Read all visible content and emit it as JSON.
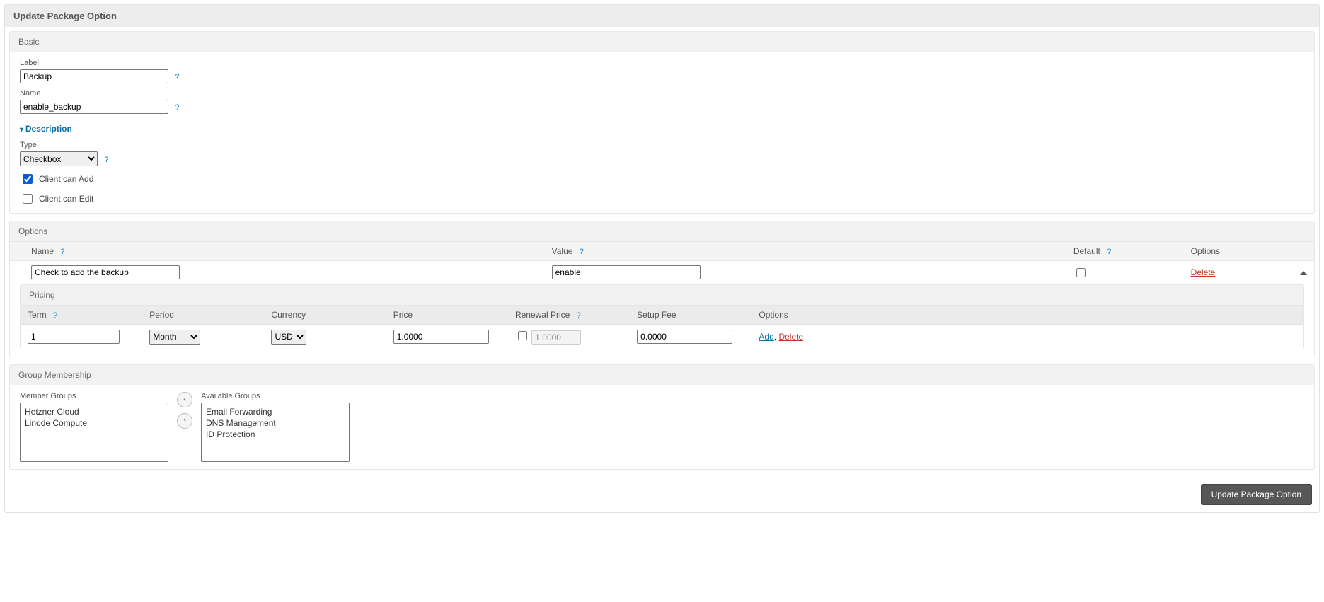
{
  "panel_title": "Update Package Option",
  "sections": {
    "basic": {
      "title": "Basic",
      "label_label": "Label",
      "label_value": "Backup",
      "name_label": "Name",
      "name_value": "enable_backup",
      "description_toggle": "Description",
      "type_label": "Type",
      "type_value": "Checkbox",
      "client_add": {
        "label": "Client can Add",
        "checked": true
      },
      "client_edit": {
        "label": "Client can Edit",
        "checked": false
      }
    },
    "options": {
      "title": "Options",
      "headers": {
        "name": "Name",
        "value": "Value",
        "default": "Default",
        "options": "Options"
      },
      "row": {
        "name_value": "Check to add the backup",
        "value_value": "enable",
        "default_checked": false,
        "delete": "Delete"
      }
    },
    "pricing": {
      "title": "Pricing",
      "headers": {
        "term": "Term",
        "period": "Period",
        "currency": "Currency",
        "price": "Price",
        "renewal": "Renewal Price",
        "setup": "Setup Fee",
        "options": "Options"
      },
      "row": {
        "term": "1",
        "period": "Month",
        "currency": "USD",
        "price": "1.0000",
        "renewal_checked": false,
        "renewal": "1.0000",
        "setup": "0.0000",
        "add": "Add",
        "sep": ", ",
        "delete": "Delete"
      }
    },
    "groups": {
      "title": "Group Membership",
      "member_label": "Member Groups",
      "available_label": "Available Groups",
      "member_items": [
        "Hetzner Cloud",
        "Linode Compute"
      ],
      "available_items": [
        "Email Forwarding",
        "DNS Management",
        "ID Protection"
      ]
    }
  },
  "submit_label": "Update Package Option",
  "help_glyph": "?"
}
